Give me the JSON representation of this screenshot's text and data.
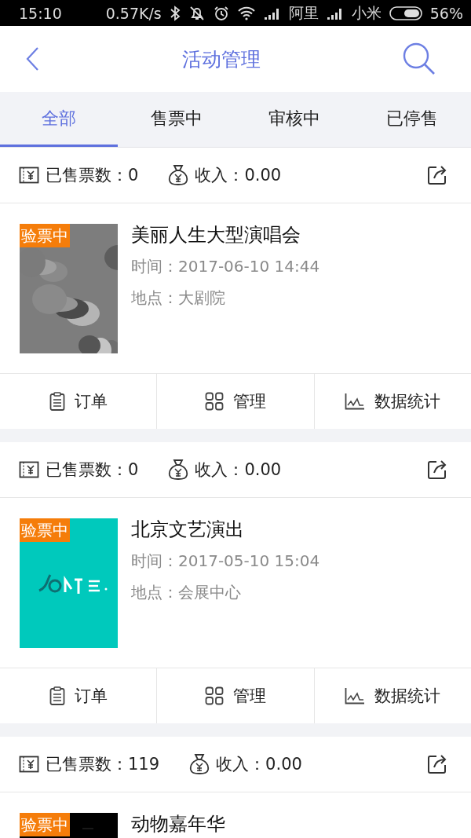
{
  "status_bar": {
    "time": "15:10",
    "speed": "0.57K/s",
    "carrier_1": "阿里",
    "carrier_2": "小米",
    "battery": "56%"
  },
  "header": {
    "title": "活动管理"
  },
  "tabs": [
    {
      "label": "全部",
      "selected": true
    },
    {
      "label": "售票中",
      "selected": false
    },
    {
      "label": "审核中",
      "selected": false
    },
    {
      "label": "已停售",
      "selected": false
    }
  ],
  "events": [
    {
      "sold": "已售票数：0",
      "income": "收入：0.00",
      "badge": "验票中",
      "title": "美丽人生大型演唱会",
      "time": "时间：2017-06-10 14:44",
      "place": "地点：大剧院",
      "actions": [
        "订单",
        "管理",
        "数据统计"
      ]
    },
    {
      "sold": "已售票数：0",
      "income": "收入：0.00",
      "badge": "验票中",
      "title": "北京文艺演出",
      "time": "时间：2017-05-10 15:04",
      "place": "地点：会展中心",
      "actions": [
        "订单",
        "管理",
        "数据统计"
      ]
    },
    {
      "sold": "已售票数：119",
      "income": "收入：0.00",
      "badge": "验票中",
      "title": "动物嘉年华"
    }
  ]
}
